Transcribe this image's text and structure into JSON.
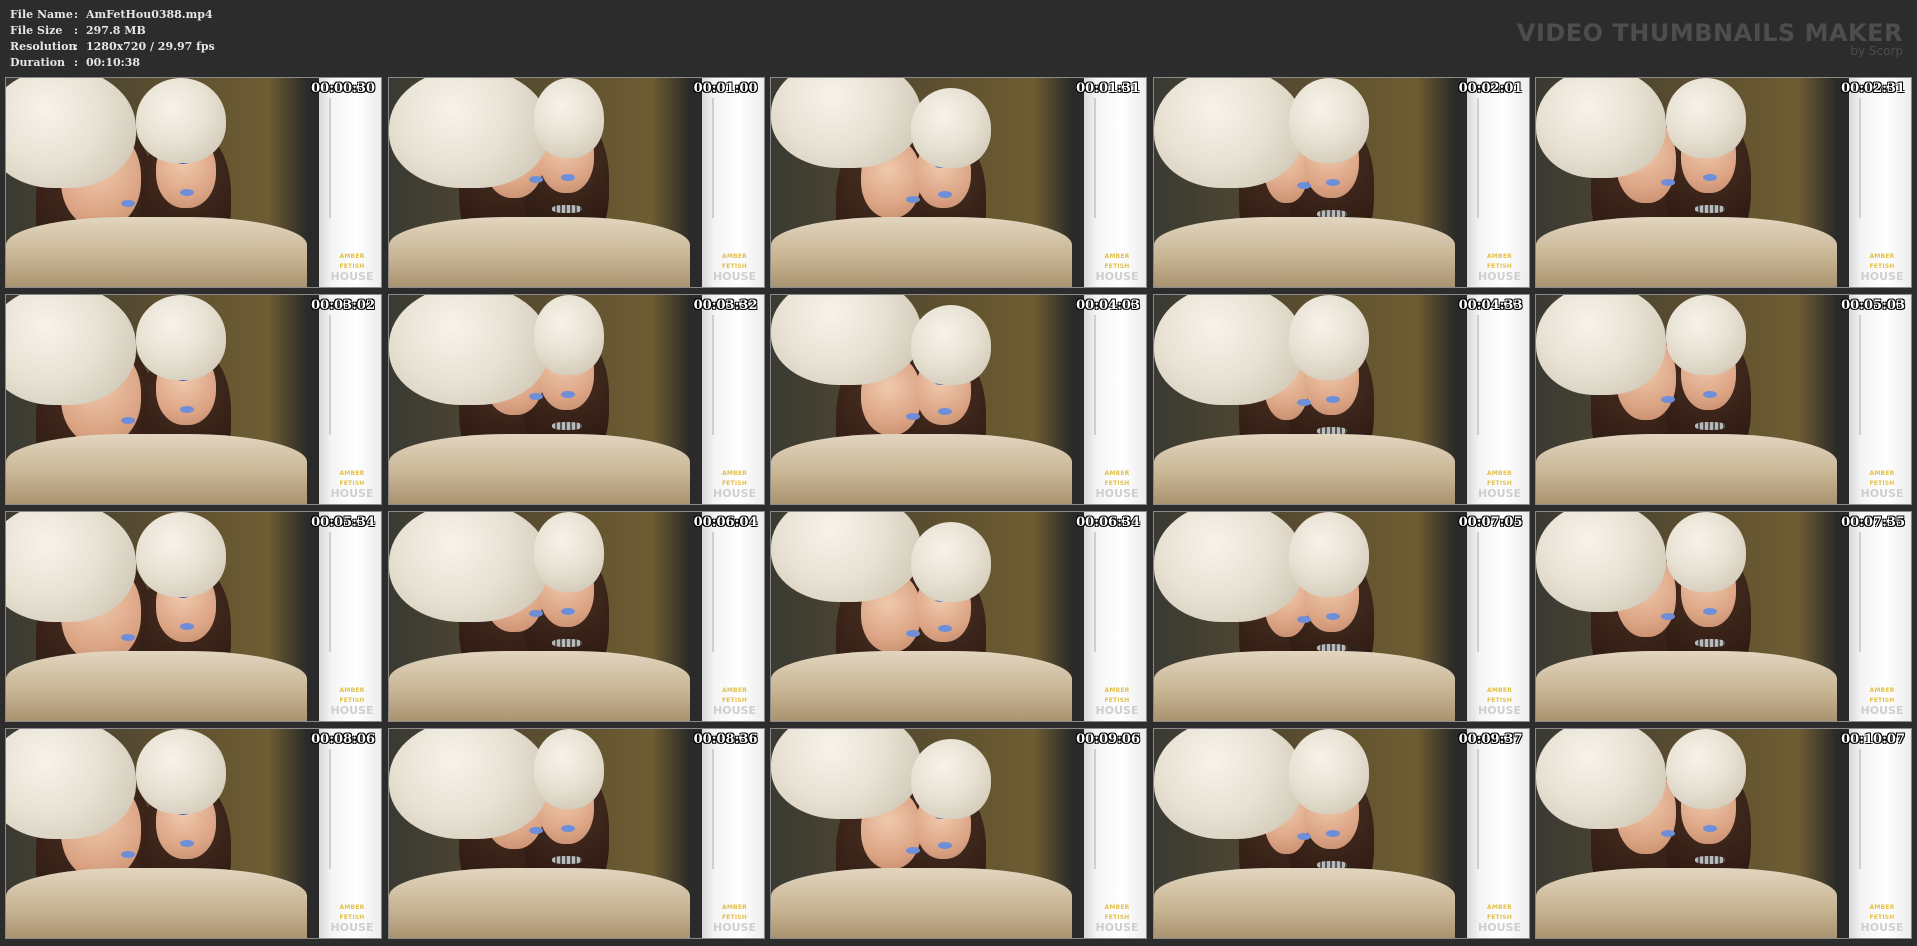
{
  "file_info": {
    "rows": [
      {
        "label": "File Name",
        "sep": ":",
        "value": "AmFetHou0388.mp4"
      },
      {
        "label": "File Size",
        "sep": ":",
        "value": "297.8 MB"
      },
      {
        "label": "Resolution",
        "sep": ":",
        "value": "1280x720 / 29.97 fps"
      },
      {
        "label": "Duration",
        "sep": ":",
        "value": "00:10:38"
      }
    ]
  },
  "brand": {
    "title": "VIDEO THUMBNAILS MAKER",
    "by": "by Scorp"
  },
  "watermark": {
    "top": "AMBER FETISH",
    "bottom": "HOUSE"
  },
  "thumbnails": [
    {
      "time": "00:00:30"
    },
    {
      "time": "00:01:00"
    },
    {
      "time": "00:01:31"
    },
    {
      "time": "00:02:01"
    },
    {
      "time": "00:02:31"
    },
    {
      "time": "00:03:02"
    },
    {
      "time": "00:03:32"
    },
    {
      "time": "00:04:03"
    },
    {
      "time": "00:04:33"
    },
    {
      "time": "00:05:03"
    },
    {
      "time": "00:05:34"
    },
    {
      "time": "00:06:04"
    },
    {
      "time": "00:06:34"
    },
    {
      "time": "00:07:05"
    },
    {
      "time": "00:07:35"
    },
    {
      "time": "00:08:06"
    },
    {
      "time": "00:08:36"
    },
    {
      "time": "00:09:06"
    },
    {
      "time": "00:09:37"
    },
    {
      "time": "00:10:07"
    }
  ]
}
